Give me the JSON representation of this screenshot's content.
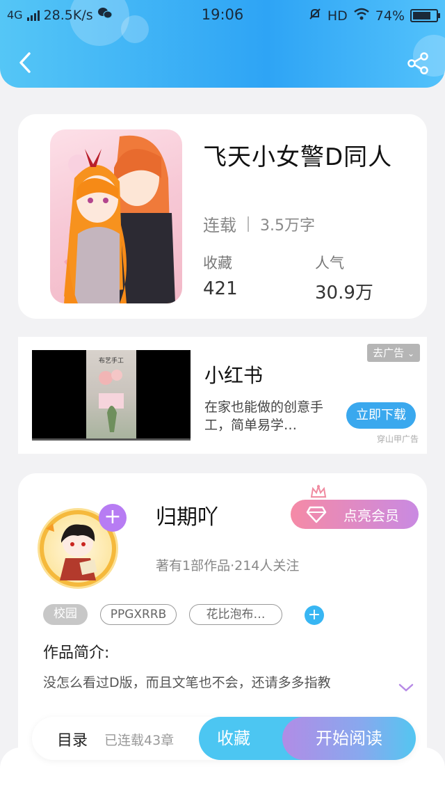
{
  "status_bar": {
    "network": "4G",
    "speed": "28.5K/s",
    "time": "19:06",
    "hd": "HD",
    "battery": "74%"
  },
  "book": {
    "title": "飞天小女警D同人",
    "status": "连载",
    "word_count": "3.5万字",
    "favorites_label": "收藏",
    "favorites_value": "421",
    "popularity_label": "人气",
    "popularity_value": "30.9万"
  },
  "ad": {
    "title": "小红书",
    "description": "在家也能做的创意手工，简单易学…",
    "close_label": "去广告",
    "download_label": "立即下载",
    "source": "穿山甲广告",
    "video_caption": "布艺手工"
  },
  "author": {
    "name": "归期吖",
    "stats": "著有1部作品·214人关注",
    "vip_label": "点亮会员",
    "follow_symbol": "+"
  },
  "tags": [
    "校园",
    "PPGXRRB",
    "花比泡布…"
  ],
  "tag_add": "+",
  "intro": {
    "title": "作品简介:",
    "text": "没怎么看过D版，而且文笔也不会，还请多多指教"
  },
  "bottom_bar": {
    "toc_label": "目录",
    "chapters": "已连载43章",
    "collect_label": "收藏",
    "read_label": "开始阅读"
  },
  "colors": {
    "header_start": "#55c6f6",
    "header_end": "#2ea4f5",
    "accent_blue": "#3aa8ee",
    "vip_pink": "#f58aa6",
    "vip_purple": "#c98ae2",
    "avatar_plus": "#b77cf3"
  },
  "icons": {
    "back": "back-arrow-icon",
    "share": "share-icon",
    "crown": "crown-icon",
    "diamond": "diamond-icon",
    "expand": "chevron-down-icon"
  }
}
